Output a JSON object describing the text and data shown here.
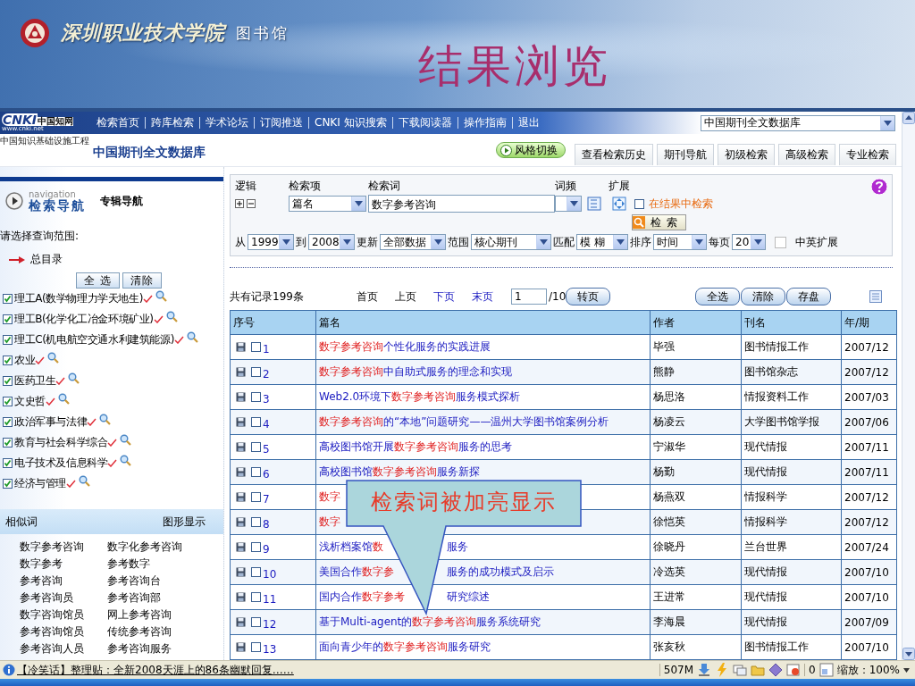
{
  "banner": {
    "school": "深圳职业技术学院",
    "library": "图书馆",
    "title": "结果浏览"
  },
  "toolbar": {
    "logo": "CNKI",
    "logo_cn": "中国知网",
    "logo_url": "www.cnki.net",
    "tagline": "中国知识基础设施工程",
    "links": [
      "检索首页",
      "跨库检索",
      "学术论坛",
      "订阅推送",
      "CNKI 知识搜索",
      "下载阅读器",
      "操作指南",
      "退出"
    ],
    "database": "中国期刊全文数据库"
  },
  "subheader": {
    "title": "中国期刊全文数据库",
    "style_button": "风格切换",
    "buttons": [
      "查看检索历史",
      "期刊导航",
      "初级检索",
      "高级检索",
      "专业检索"
    ]
  },
  "sidebar": {
    "nav_small": "navigation",
    "nav_title": "检索导航",
    "nav_tab": "专辑导航",
    "prompt": "请选择查询范围:",
    "root": "总目录",
    "select_all": "全 选",
    "clear": "清除",
    "categories": [
      {
        "label": "理工A(数学物理力学天地生)",
        "checked": true
      },
      {
        "label": "理工B(化学化工冶金环境矿业)",
        "checked": true
      },
      {
        "label": "理工C(机电航空交通水利建筑能源)",
        "checked": true
      },
      {
        "label": "农业",
        "checked": true
      },
      {
        "label": "医药卫生",
        "checked": true
      },
      {
        "label": "文史哲",
        "checked": true
      },
      {
        "label": "政治军事与法律",
        "checked": true
      },
      {
        "label": "教育与社会科学综合",
        "checked": true
      },
      {
        "label": "电子技术及信息科学",
        "checked": true
      },
      {
        "label": "经济与管理",
        "checked": true
      }
    ],
    "similar_title": "相似词",
    "graph_link": "图形显示",
    "similar_words": [
      "数字参考咨询",
      "数字化参考咨询",
      "数字参考",
      "参考数字",
      "参考咨询",
      "参考咨询台",
      "参考咨询员",
      "参考咨询部",
      "数字咨询馆员",
      "网上参考咨询",
      "参考咨询馆员",
      "传统参考咨询",
      "参考咨询人员",
      "参考咨询服务"
    ]
  },
  "search": {
    "labels": [
      "逻辑",
      "检索项",
      "检索词",
      "词频",
      "扩展"
    ],
    "field": "篇名",
    "term": "数字参考咨询",
    "in_results": {
      "label": "在结果中检索",
      "checked": false
    },
    "search_button": "检 索",
    "filters": [
      {
        "label": "从",
        "value": "1999"
      },
      {
        "label": "到",
        "value": "2008"
      },
      {
        "label": "更新",
        "value": "全部数据"
      },
      {
        "label": "范围",
        "value": "核心期刊"
      },
      {
        "label": "匹配",
        "value": "模 糊"
      },
      {
        "label": "排序",
        "value": "时间"
      },
      {
        "label": "每页",
        "value": "20"
      }
    ],
    "cn_en": {
      "label": "中英扩展",
      "checked": false
    }
  },
  "results": {
    "total": "共有记录199条",
    "pager": [
      {
        "label": "首页",
        "enabled": false
      },
      {
        "label": "上页",
        "enabled": false
      },
      {
        "label": "下页",
        "enabled": true
      },
      {
        "label": "末页",
        "enabled": true
      }
    ],
    "page": "1",
    "pages": "/10",
    "go_button": "转页",
    "actions": [
      "全选",
      "清除",
      "存盘"
    ],
    "columns": [
      "序号",
      "篇名",
      "作者",
      "刊名",
      "年/期"
    ],
    "rows": [
      {
        "number": "1",
        "checked": false,
        "title": [
          {
            "text": "数字参考咨询",
            "hit": true
          },
          {
            "text": "个性化服务的实践进展",
            "hit": false
          }
        ],
        "author": "毕强",
        "journal": "图书情报工作",
        "issue": "2007/12"
      },
      {
        "number": "2",
        "checked": false,
        "title": [
          {
            "text": "数字参考咨询",
            "hit": true
          },
          {
            "text": "中自助式服务的理念和实现",
            "hit": false
          }
        ],
        "author": "熊静",
        "journal": "图书馆杂志",
        "issue": "2007/12"
      },
      {
        "number": "3",
        "checked": false,
        "title": [
          {
            "text": "Web2.0环境下",
            "hit": false
          },
          {
            "text": "数字参考咨询",
            "hit": true
          },
          {
            "text": "服务模式探析",
            "hit": false
          }
        ],
        "author": "杨思洛",
        "journal": "情报资料工作",
        "issue": "2007/03"
      },
      {
        "number": "4",
        "checked": false,
        "title": [
          {
            "text": "数字参考咨询",
            "hit": true
          },
          {
            "text": "的“本地”问题研究——温州大学图书馆案例分析",
            "hit": false
          }
        ],
        "author": "杨凌云",
        "journal": "大学图书馆学报",
        "issue": "2007/06"
      },
      {
        "number": "5",
        "checked": false,
        "title": [
          {
            "text": "高校图书馆开展",
            "hit": false
          },
          {
            "text": "数字参考咨询",
            "hit": true
          },
          {
            "text": "服务的思考",
            "hit": false
          }
        ],
        "author": "宁淑华",
        "journal": "现代情报",
        "issue": "2007/11"
      },
      {
        "number": "6",
        "checked": false,
        "title": [
          {
            "text": "高校图书馆",
            "hit": false
          },
          {
            "text": "数字参考咨询",
            "hit": true
          },
          {
            "text": "服务新探",
            "hit": false
          }
        ],
        "author": "杨勤",
        "journal": "现代情报",
        "issue": "2007/11"
      },
      {
        "number": "7",
        "checked": false,
        "title": [
          {
            "text": "数字",
            "hit": true
          }
        ],
        "author": "杨燕双",
        "journal": "情报科学",
        "issue": "2007/12"
      },
      {
        "number": "8",
        "checked": false,
        "title": [
          {
            "text": "数字",
            "hit": true
          }
        ],
        "author": "徐恺英",
        "journal": "情报科学",
        "issue": "2007/12"
      },
      {
        "number": "9",
        "checked": false,
        "title": [
          {
            "text": "浅析档案馆",
            "hit": false
          },
          {
            "text": "数",
            "hit": true
          }
        ],
        "tail": [
          {
            "text": "服务",
            "hit": false
          }
        ],
        "author": "徐晓丹",
        "journal": "兰台世界",
        "issue": "2007/24"
      },
      {
        "number": "10",
        "checked": false,
        "title": [
          {
            "text": "美国合作",
            "hit": false
          },
          {
            "text": "数字参",
            "hit": true
          }
        ],
        "tail": [
          {
            "text": "服务的成功模式及启示",
            "hit": false
          }
        ],
        "author": "冷选英",
        "journal": "现代情报",
        "issue": "2007/10"
      },
      {
        "number": "11",
        "checked": false,
        "title": [
          {
            "text": "国内合作",
            "hit": false
          },
          {
            "text": "数字参考",
            "hit": true
          }
        ],
        "tail": [
          {
            "text": "研究综述",
            "hit": false
          }
        ],
        "author": "王进常",
        "journal": "现代情报",
        "issue": "2007/10"
      },
      {
        "number": "12",
        "checked": false,
        "title": [
          {
            "text": "基于Multi-agent的",
            "hit": false
          },
          {
            "text": "数字参考咨询",
            "hit": true
          },
          {
            "text": "服务系统研究",
            "hit": false
          }
        ],
        "author": "李海晨",
        "journal": "现代情报",
        "issue": "2007/09"
      },
      {
        "number": "13",
        "checked": false,
        "title": [
          {
            "text": "面向青少年的",
            "hit": false
          },
          {
            "text": "数字参考咨询",
            "hit": true
          },
          {
            "text": "服务研究",
            "hit": false
          }
        ],
        "author": "张亥秋",
        "journal": "图书情报工作",
        "issue": "2007/10"
      }
    ]
  },
  "callout": {
    "text": "检索词被加亮显示"
  },
  "status_bar": {
    "message": "【冷笑话】整理贴：全新2008天涯上的86条幽默回复……",
    "memory": "507M",
    "count": "0",
    "zoom": "缩放：100%"
  }
}
